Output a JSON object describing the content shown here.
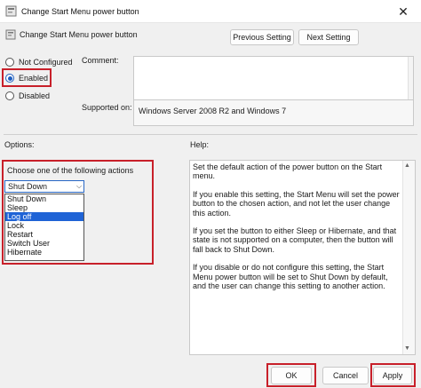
{
  "window": {
    "title": "Change Start Menu power button",
    "close_glyph": "✕"
  },
  "header": {
    "policy_title": "Change Start Menu power button",
    "prev_label": "Previous Setting",
    "next_label": "Next Setting"
  },
  "state": {
    "options": [
      {
        "label": "Not Configured",
        "selected": false
      },
      {
        "label": "Enabled",
        "selected": true
      },
      {
        "label": "Disabled",
        "selected": false
      }
    ]
  },
  "comment": {
    "label": "Comment:",
    "value": ""
  },
  "supported": {
    "label": "Supported on:",
    "value": "Windows Server 2008 R2 and Windows 7"
  },
  "options_section": {
    "label": "Options:",
    "caption": "Choose one of the following actions",
    "selected_value": "Shut Down",
    "dropdown_items": [
      "Shut Down",
      "Sleep",
      "Log off",
      "Lock",
      "Restart",
      "Switch User",
      "Hibernate"
    ],
    "highlighted_item": "Log off"
  },
  "help_section": {
    "label": "Help:",
    "paragraphs": [
      "Set the default action of the power button on the Start menu.",
      "If you enable this setting, the Start Menu will set the power button to the chosen action, and not let the user change this action.",
      "If you set the button to either Sleep or Hibernate, and that state is not supported on a computer, then the button will fall back to Shut Down.",
      "If you disable or do not configure this setting, the Start Menu power button will be set to Shut Down by default, and the user can change this setting to another action."
    ]
  },
  "footer": {
    "ok_label": "OK",
    "cancel_label": "Cancel",
    "apply_label": "Apply"
  },
  "colors": {
    "highlight_border": "#c8202a",
    "selection_blue": "#1f63d6"
  }
}
